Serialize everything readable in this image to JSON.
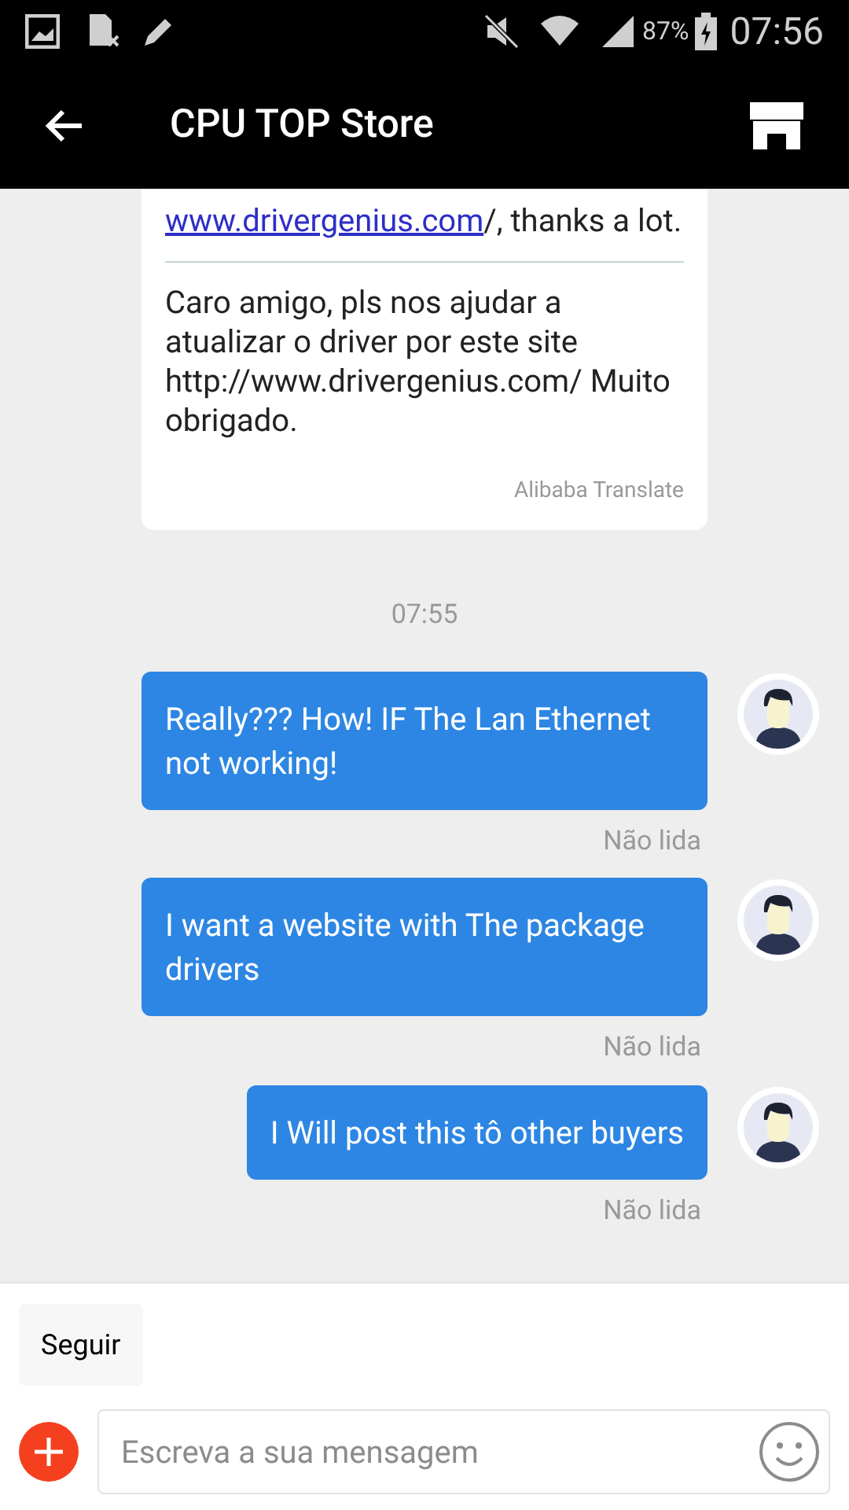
{
  "status_bar": {
    "battery": "87%",
    "time": "07:56"
  },
  "header": {
    "title": "CPU TOP Store"
  },
  "translated_card": {
    "link": "www.drivergenius.com",
    "original_after": "/,  thanks a lot.",
    "translation": "Caro amigo, pls nos ajudar a atualizar o driver por este site http://www.drivergenius.com/ Muito obrigado.",
    "source": "Alibaba Translate"
  },
  "timestamp": "07:55",
  "messages": [
    {
      "text": "Really??? How! IF The Lan Ethernet not working!",
      "status": "Não lida"
    },
    {
      "text": "I want  a website with The package drivers",
      "status": "Não lida"
    },
    {
      "text": "I Will post this tô other buyers",
      "status": "Não lida"
    }
  ],
  "follow_button": "Seguir",
  "composer": {
    "placeholder": "Escreva a sua mensagem"
  }
}
